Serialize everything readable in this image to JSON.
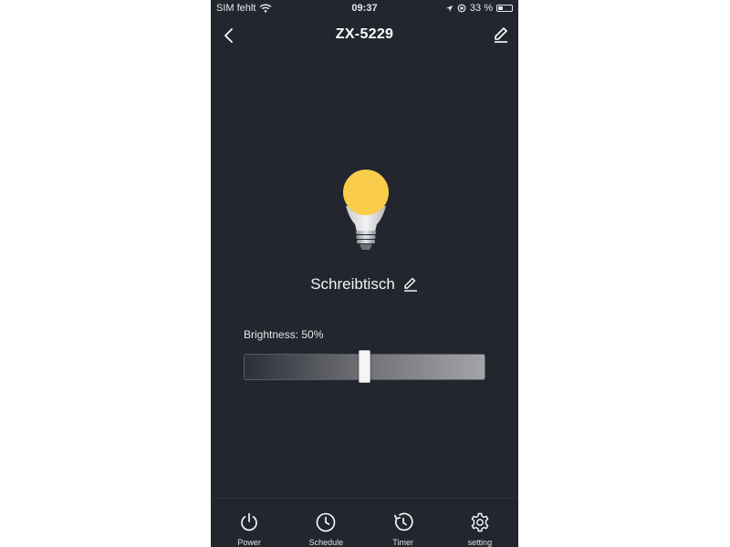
{
  "status_bar": {
    "carrier": "SIM fehlt",
    "time": "09:37",
    "battery": "33 %",
    "battery_level": 0.33
  },
  "header": {
    "title": "ZX-5229"
  },
  "device": {
    "name": "Schreibtisch",
    "bulb_color": "#f9cc4a"
  },
  "brightness": {
    "label": "Brightness: 50%",
    "value": 50
  },
  "bottom_nav": {
    "items": [
      {
        "label": "Power",
        "icon": "power-icon"
      },
      {
        "label": "Schedule",
        "icon": "clock-icon"
      },
      {
        "label": "Timer",
        "icon": "timer-icon"
      },
      {
        "label": "setting",
        "icon": "gear-icon"
      }
    ]
  }
}
